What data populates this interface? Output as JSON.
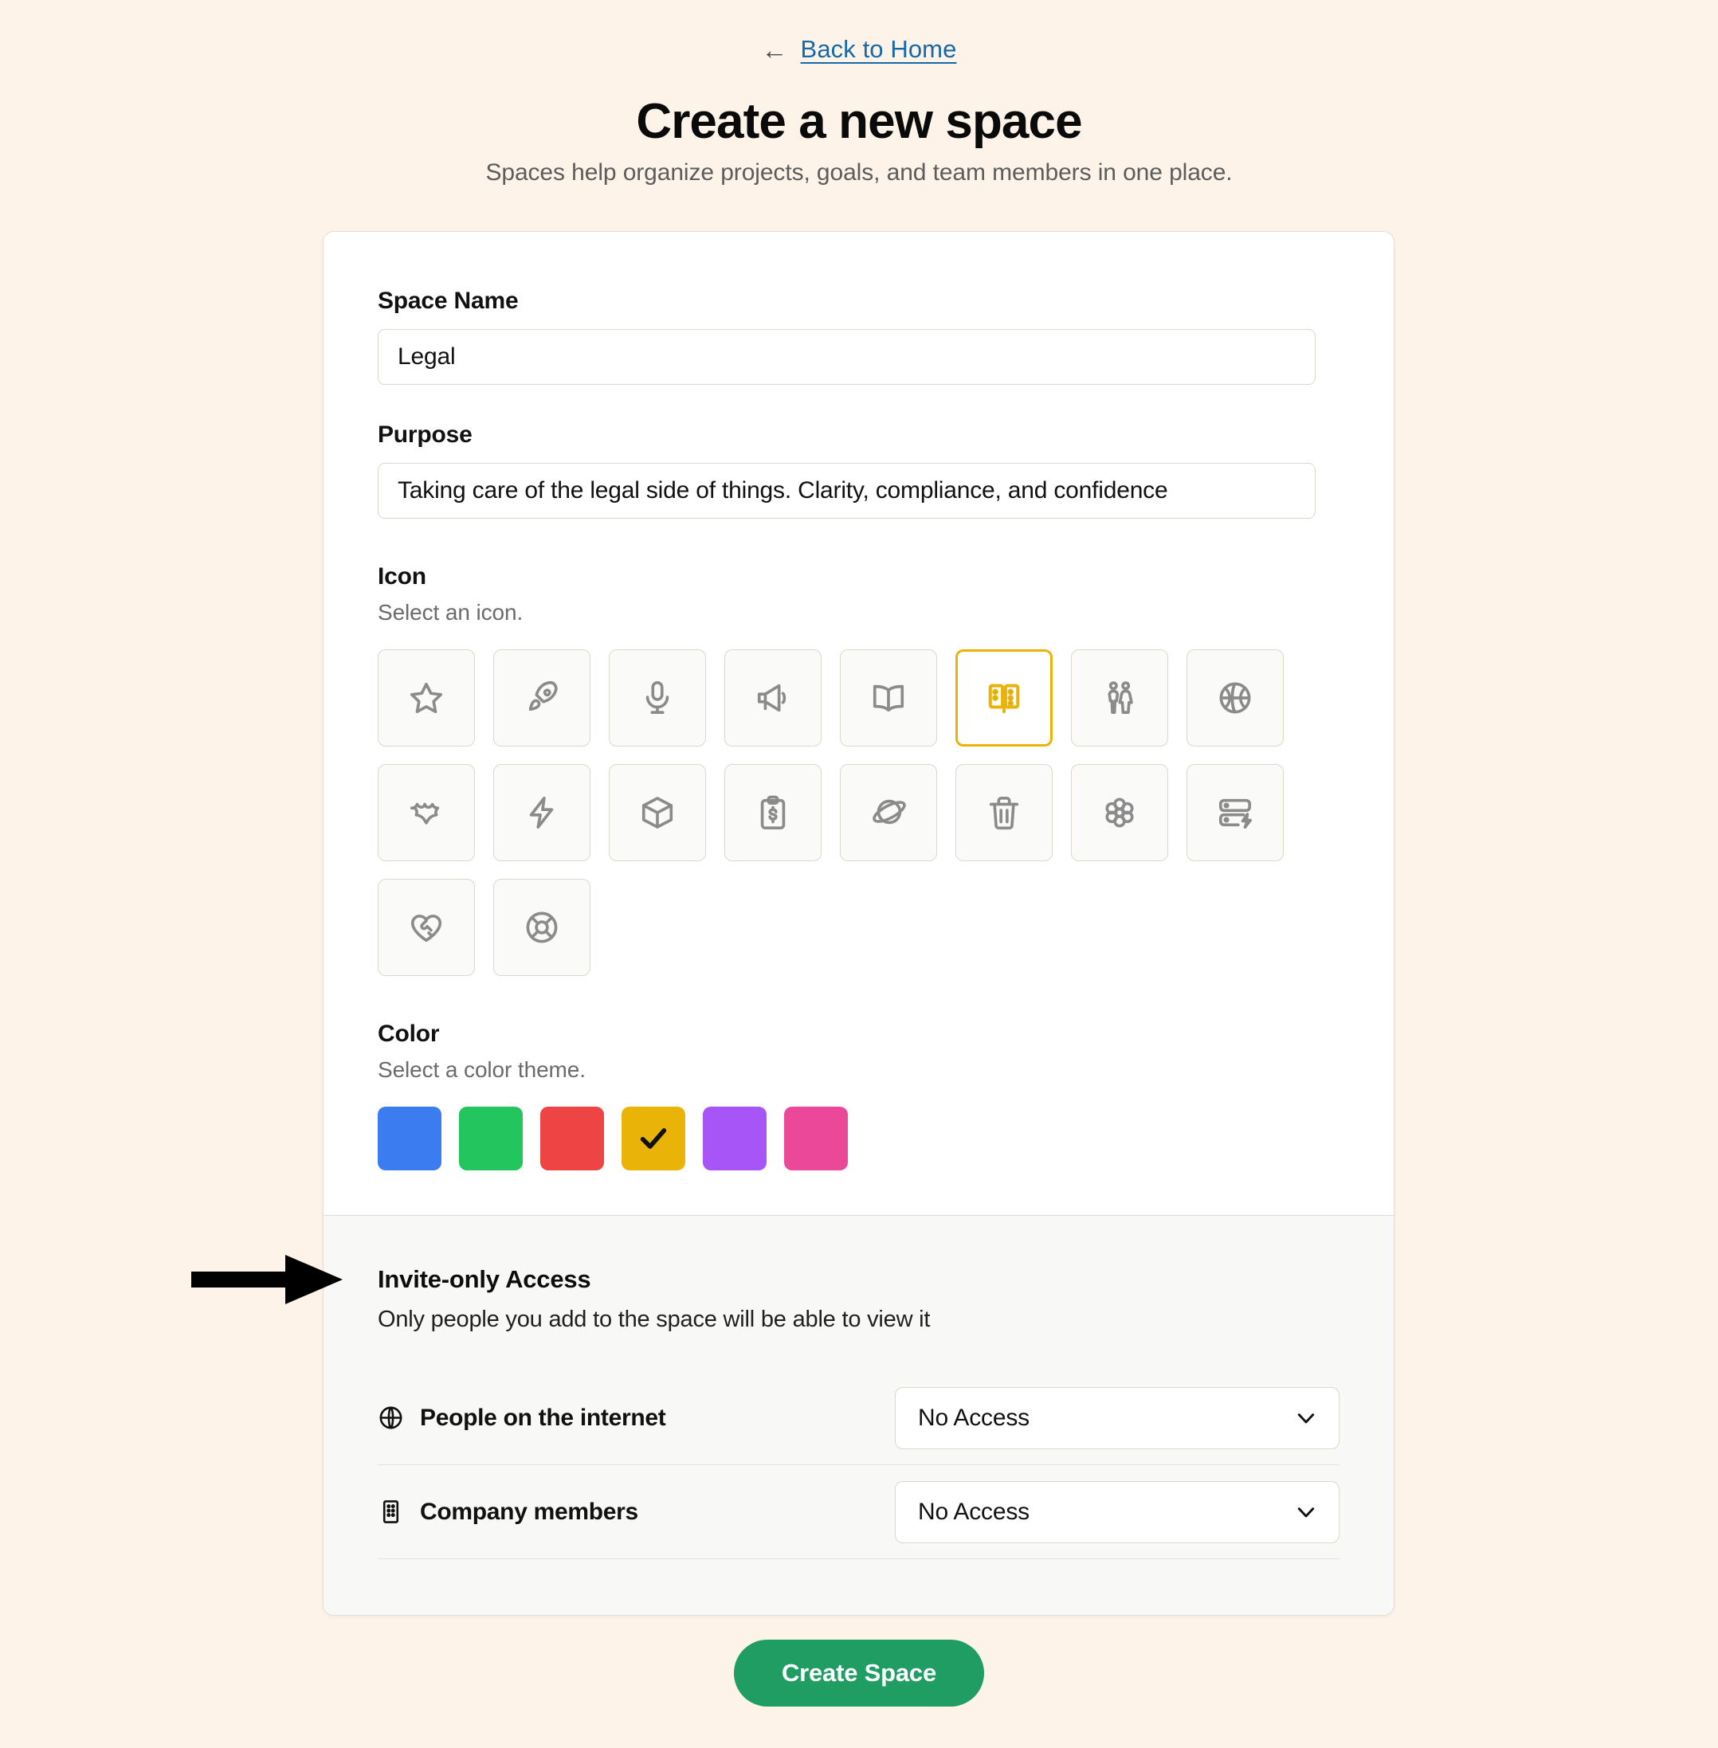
{
  "header": {
    "back_arrow_icon": "arrow-left-icon",
    "back_label": "Back to Home",
    "title": "Create a new space",
    "subtitle": "Spaces help organize projects, goals, and team members in one place."
  },
  "form": {
    "space_name": {
      "label": "Space Name",
      "value": "Legal",
      "placeholder": "Space Name"
    },
    "purpose": {
      "label": "Purpose",
      "value": "Taking care of the legal side of things. Clarity, compliance, and confidence",
      "placeholder": "Purpose"
    },
    "icon_section": {
      "label": "Icon",
      "description": "Select an icon.",
      "selected_index": 5,
      "options": [
        {
          "name": "star-icon"
        },
        {
          "name": "rocket-icon"
        },
        {
          "name": "microphone-icon"
        },
        {
          "name": "megaphone-icon"
        },
        {
          "name": "book-open-icon"
        },
        {
          "name": "book-dashed-icon"
        },
        {
          "name": "restroom-people-icon"
        },
        {
          "name": "basketball-icon"
        },
        {
          "name": "bat-icon"
        },
        {
          "name": "lightning-bolt-icon"
        },
        {
          "name": "cube-icon"
        },
        {
          "name": "clipboard-dollar-icon"
        },
        {
          "name": "planet-icon"
        },
        {
          "name": "trash-icon"
        },
        {
          "name": "flower-icon"
        },
        {
          "name": "server-bolt-icon"
        },
        {
          "name": "heart-handshake-icon"
        },
        {
          "name": "lifebuoy-icon"
        }
      ]
    },
    "color_section": {
      "label": "Color",
      "description": "Select a color theme.",
      "selected_index": 3,
      "check_icon": "check-icon",
      "options": [
        {
          "name": "blue",
          "hex": "#3b7cf0"
        },
        {
          "name": "green",
          "hex": "#22c55e"
        },
        {
          "name": "red",
          "hex": "#ef4444"
        },
        {
          "name": "amber",
          "hex": "#eab308"
        },
        {
          "name": "purple",
          "hex": "#a855f7"
        },
        {
          "name": "pink",
          "hex": "#ec4899"
        }
      ]
    }
  },
  "access": {
    "title": "Invite-only Access",
    "description": "Only people you add to the space will be able to view it",
    "rows": [
      {
        "icon": "globe-icon",
        "label": "People on the internet",
        "value": "No Access",
        "chevron_icon": "chevron-down-icon"
      },
      {
        "icon": "building-icon",
        "label": "Company members",
        "value": "No Access",
        "chevron_icon": "chevron-down-icon"
      }
    ]
  },
  "footer": {
    "submit_label": "Create Space",
    "submit_color": "#1f9d63"
  },
  "annotation": {
    "name": "pointer-arrow",
    "target": "Invite-only Access",
    "color": "#000000"
  }
}
